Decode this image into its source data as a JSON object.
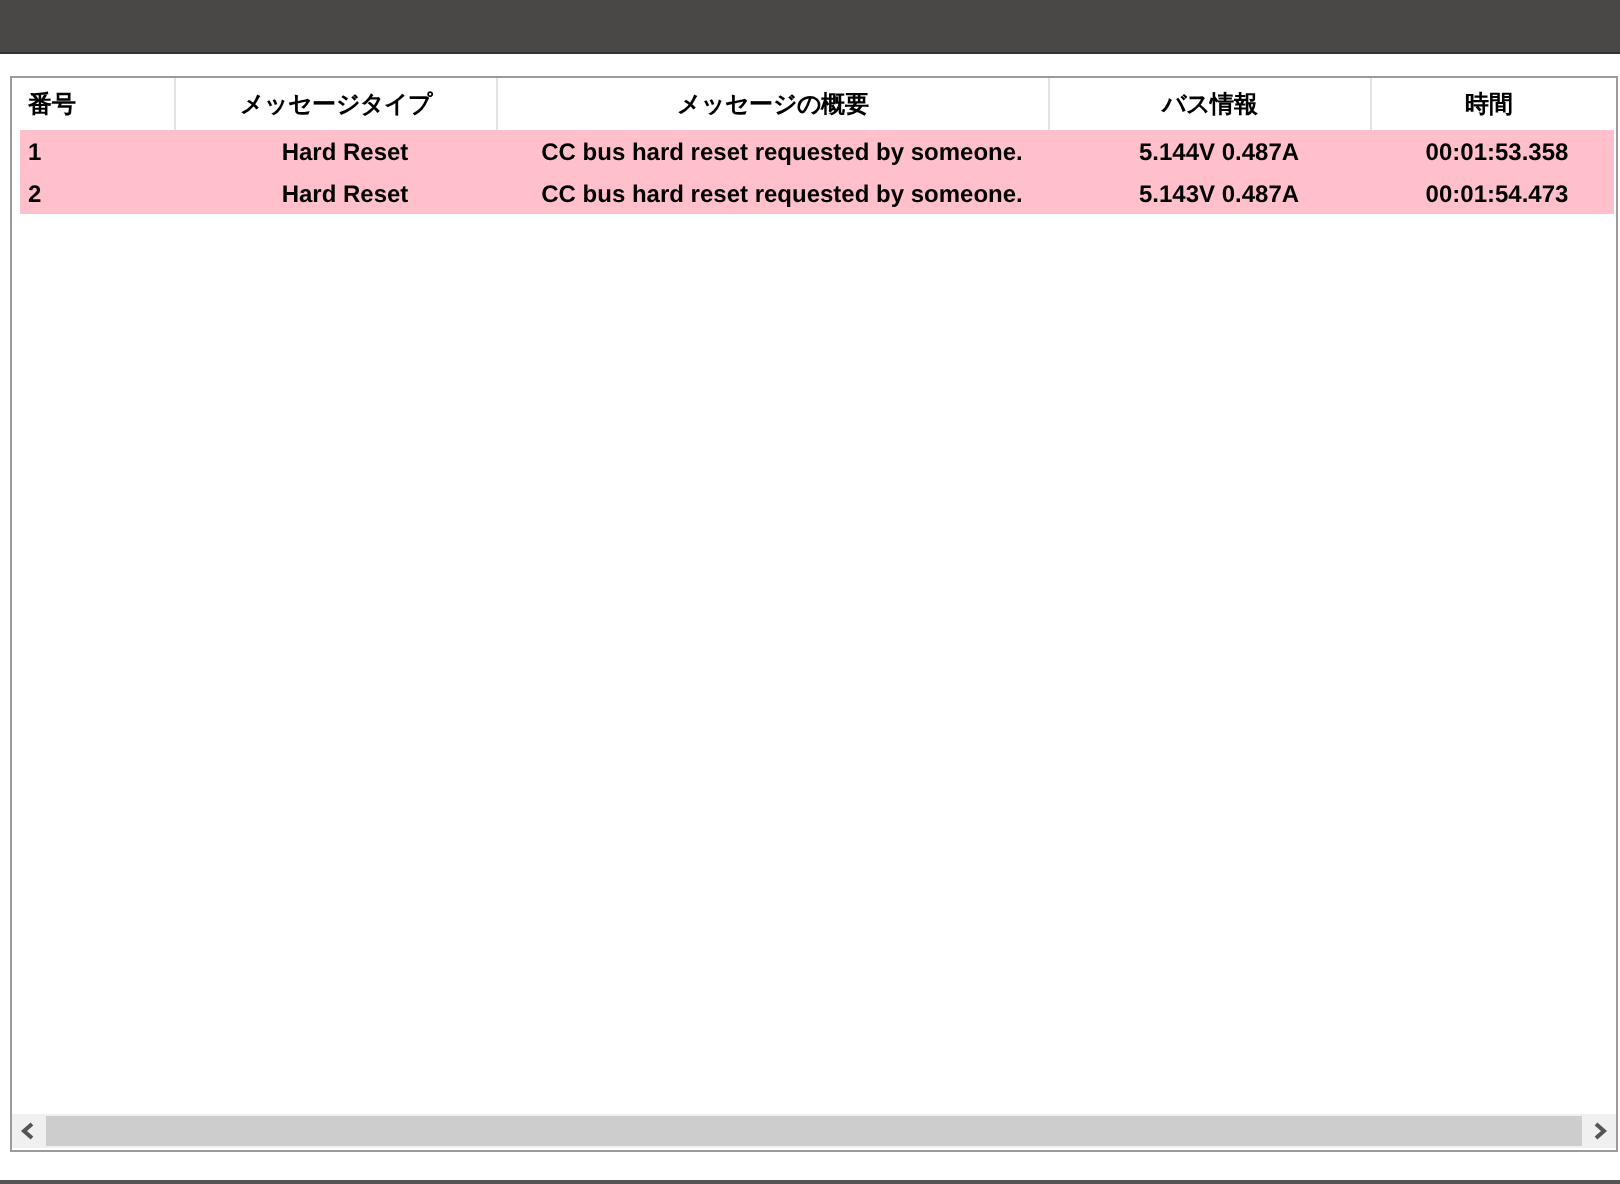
{
  "table": {
    "columns": [
      "番号",
      "メッセージタイプ",
      "メッセージの概要",
      "バス情報",
      "時間"
    ],
    "rows": [
      {
        "cells": [
          "1",
          "Hard Reset",
          "CC bus hard reset requested by someone.",
          "5.144V 0.487A",
          "00:01:53.358"
        ]
      },
      {
        "cells": [
          "2",
          "Hard Reset",
          "CC bus hard reset requested by someone.",
          "5.143V 0.487A",
          "00:01:54.473"
        ]
      }
    ]
  }
}
